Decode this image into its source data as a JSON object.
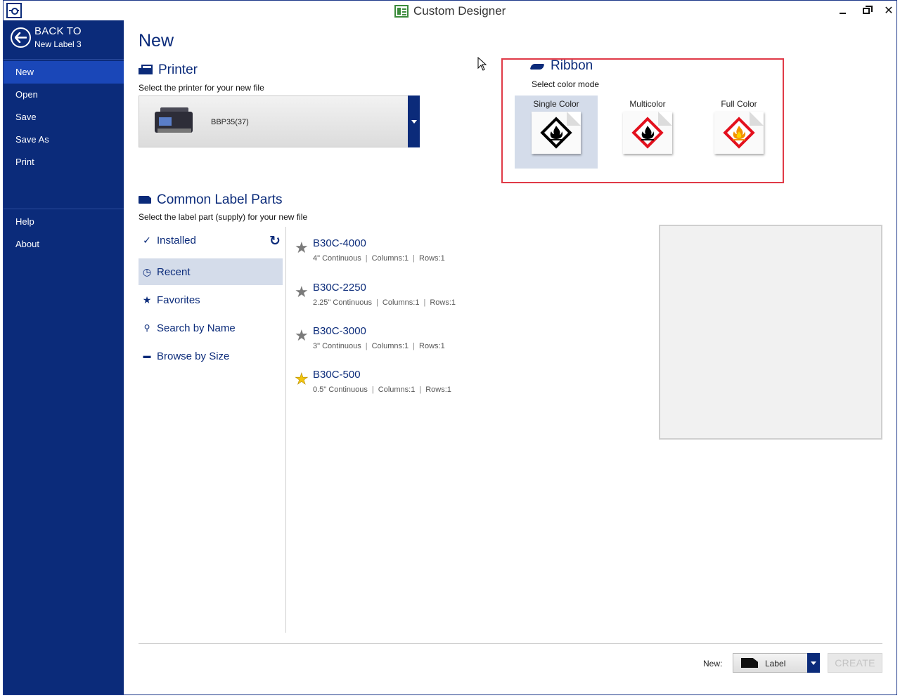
{
  "window": {
    "title": "Custom Designer",
    "minimize": "",
    "maximize": "",
    "close": "✕"
  },
  "sidebar": {
    "back_title": "BACK TO",
    "back_subtitle": "New Label 3",
    "items": [
      {
        "label": "New",
        "active": true
      },
      {
        "label": "Open"
      },
      {
        "label": "Save"
      },
      {
        "label": "Save As"
      },
      {
        "label": "Print"
      }
    ],
    "bottom_items": [
      {
        "label": "Help"
      },
      {
        "label": "About"
      }
    ]
  },
  "main": {
    "title": "New",
    "printer": {
      "heading": "Printer",
      "subtitle": "Select the printer for your new file",
      "selected": "BBP35(37)"
    },
    "ribbon": {
      "heading": "Ribbon",
      "subtitle": "Select color mode",
      "modes": [
        {
          "label": "Single Color",
          "selected": true,
          "border_color": "#000000",
          "flame_color": "#000000"
        },
        {
          "label": "Multicolor",
          "selected": false,
          "border_color": "#e3101d",
          "flame_color": "#000000"
        },
        {
          "label": "Full Color",
          "selected": false,
          "border_color": "#e3101d",
          "flame_color": "#f39200"
        }
      ]
    },
    "label_parts": {
      "heading": "Common Label Parts",
      "subtitle": "Select the label part (supply) for your new file",
      "filters": [
        {
          "label": "Installed",
          "icon": "checkmark-icon",
          "glyph": "✓"
        },
        {
          "label": "Recent",
          "icon": "clock-icon",
          "glyph": "◷",
          "active": true
        },
        {
          "label": "Favorites",
          "icon": "star-icon",
          "glyph": "★"
        },
        {
          "label": "Search by Name",
          "icon": "search-icon",
          "glyph": "⚲"
        },
        {
          "label": "Browse by Size",
          "icon": "folder-icon",
          "glyph": "▬"
        }
      ],
      "refresh_glyph": "↻",
      "parts": [
        {
          "name": "B30C-4000",
          "desc": "4\" Continuous",
          "columns": "Columns:1",
          "rows": "Rows:1",
          "favorite": false
        },
        {
          "name": "B30C-2250",
          "desc": "2.25\" Continuous",
          "columns": "Columns:1",
          "rows": "Rows:1",
          "favorite": false
        },
        {
          "name": "B30C-3000",
          "desc": "3\" Continuous",
          "columns": "Columns:1",
          "rows": "Rows:1",
          "favorite": false
        },
        {
          "name": "B30C-500",
          "desc": "0.5\" Continuous",
          "columns": "Columns:1",
          "rows": "Rows:1",
          "favorite": true
        }
      ]
    },
    "footer": {
      "new_label": "New:",
      "new_type": "Label",
      "create": "CREATE"
    }
  },
  "colors": {
    "brand": "#0b2b7a",
    "highlight": "#e03a47",
    "selected_bg": "#d4dcea"
  }
}
